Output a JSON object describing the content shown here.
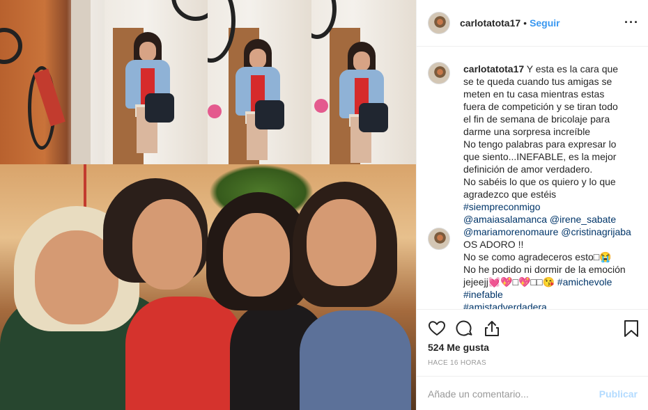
{
  "post": {
    "photo_alt": "",
    "username": "carlotatota17",
    "separator": "•",
    "follow_label": "Seguir",
    "more_label": "···"
  },
  "caption": {
    "username": "carlotatota17",
    "lines": [
      " Y esta es la cara que",
      "se te queda cuando tus amigas se",
      "meten en tu casa mientras estas",
      "fuera de competición y se tiran todo",
      "el fin de semana de bricolaje para",
      "darme una sorpresa increíble",
      "No tengo palabras para expresar lo",
      "que siento...INEFABLE, es la mejor",
      "definición de amor verdadero.",
      "No sabéis lo que os quiero y lo que",
      "agradezco que estéis"
    ],
    "hashtag_1": "#siempreconmigo",
    "mentions_1": "@amaiasalamanca @irene_sabate",
    "mentions_2": "@mariamorenomaure @cristinagrijaba",
    "line_adoro": "OS ADORO !!",
    "line_agradeceros": "No se como agradeceros esto□😭",
    "line_dormir": "No he podido ni dormir de la emoción",
    "line_jejeejj_text": "jejeejj💓💖□💖□□😘 ",
    "hashtag_2": "#amichevole",
    "hashtag_3": "#inefable",
    "hashtag_4": "#amistadverdadera"
  },
  "actions": {
    "icons": [
      "heart-icon",
      "comment-icon",
      "share-icon",
      "bookmark-icon"
    ],
    "likes": "524 Me gusta",
    "time": "HACE 16 HORAS",
    "comment_placeholder": "Añade un comentario...",
    "publish_label": "Publicar"
  },
  "colors": {
    "accent": "#3897f0",
    "publish_disabled": "#b3dbff",
    "hashtag": "#003569",
    "border": "#efefef",
    "text": "#262626",
    "muted": "#999999"
  }
}
